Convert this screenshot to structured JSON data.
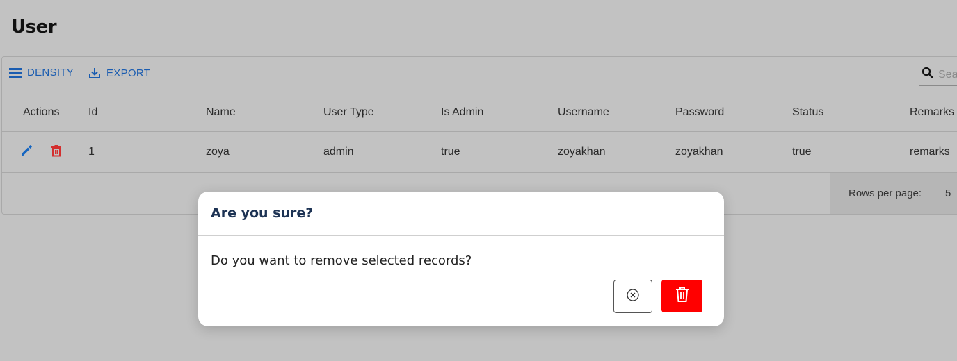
{
  "page": {
    "title": "User"
  },
  "toolbar": {
    "density_label": "DENSITY",
    "export_label": "EXPORT",
    "search_placeholder": "Search…"
  },
  "table": {
    "columns": [
      "Actions",
      "Id",
      "Name",
      "User Type",
      "Is Admin",
      "Username",
      "Password",
      "Status",
      "Remarks"
    ],
    "rows": [
      {
        "id": "1",
        "name": "zoya",
        "user_type": "admin",
        "is_admin": "true",
        "username": "zoyakhan",
        "password": "zoyakhan",
        "status": "true",
        "remarks": "remarks"
      }
    ]
  },
  "pagination": {
    "rows_per_page_label": "Rows per page:",
    "rows_per_page_value": "5"
  },
  "dialog": {
    "title": "Are you sure?",
    "message": "Do you want to remove selected records?"
  },
  "colors": {
    "accent": "#1a5cb0",
    "danger": "#ff0000",
    "edit_icon": "#1565c0",
    "delete_icon": "#d32f2f",
    "dialog_title": "#1d3354"
  },
  "icons": {
    "density": "density-icon",
    "export": "export-icon",
    "search": "search-icon",
    "edit": "pencil-icon",
    "delete": "trash-icon",
    "cancel": "close-circle-icon",
    "confirm_delete": "trash-icon"
  }
}
